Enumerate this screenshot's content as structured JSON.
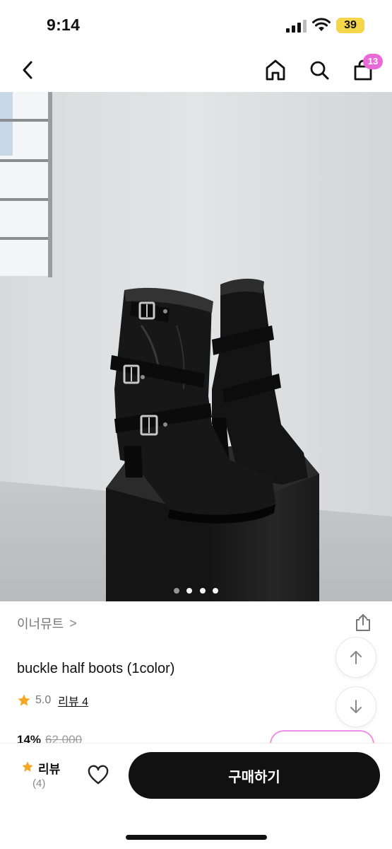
{
  "status": {
    "time": "9:14",
    "battery": "39"
  },
  "nav": {
    "cart_count": "13"
  },
  "hero": {
    "image_subject": "black buckle half boots on black pedestal",
    "slide_dots": 3
  },
  "product": {
    "brand": "이너뮤트",
    "brand_chevron": ">",
    "name": "buckle half boots (1color)",
    "rating": "5.0",
    "review_link": "리뷰 4",
    "discount": "14%",
    "original_price": "62,000"
  },
  "bottom": {
    "review_label": "리뷰",
    "review_count": "(4)",
    "buy_label": "구매하기"
  },
  "colors": {
    "accent_pink": "#e86ad7",
    "star": "#f5a623",
    "button": "#111111"
  },
  "icons": [
    "back-icon",
    "home-icon",
    "search-icon",
    "shopping-bag-icon",
    "share-icon",
    "arrow-up-icon",
    "arrow-down-icon",
    "star-icon",
    "heart-icon"
  ]
}
